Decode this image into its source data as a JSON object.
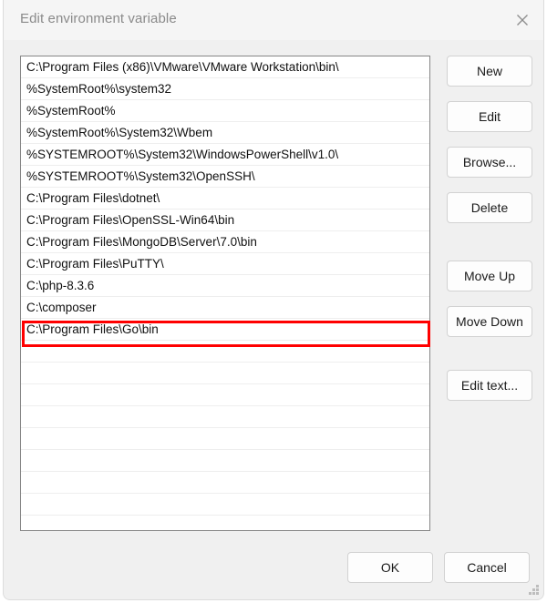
{
  "window": {
    "title": "Edit environment variable",
    "close_icon": "close-icon"
  },
  "list": {
    "entries": [
      "C:\\Program Files (x86)\\VMware\\VMware Workstation\\bin\\",
      "%SystemRoot%\\system32",
      "%SystemRoot%",
      "%SystemRoot%\\System32\\Wbem",
      "%SYSTEMROOT%\\System32\\WindowsPowerShell\\v1.0\\",
      "%SYSTEMROOT%\\System32\\OpenSSH\\",
      "C:\\Program Files\\dotnet\\",
      "C:\\Program Files\\OpenSSL-Win64\\bin",
      "C:\\Program Files\\MongoDB\\Server\\7.0\\bin",
      "C:\\Program Files\\PuTTY\\",
      "C:\\php-8.3.6",
      "C:\\composer",
      "C:\\Program Files\\Go\\bin"
    ],
    "empty_row_count": 8,
    "highlighted_index": 12,
    "highlight_color": "#ff0000"
  },
  "side_buttons": {
    "new": "New",
    "edit": "Edit",
    "browse": "Browse...",
    "delete": "Delete",
    "move_up": "Move Up",
    "move_down": "Move Down",
    "edit_text": "Edit text..."
  },
  "footer_buttons": {
    "ok": "OK",
    "cancel": "Cancel"
  },
  "resize_grip": "resize-grip-icon"
}
